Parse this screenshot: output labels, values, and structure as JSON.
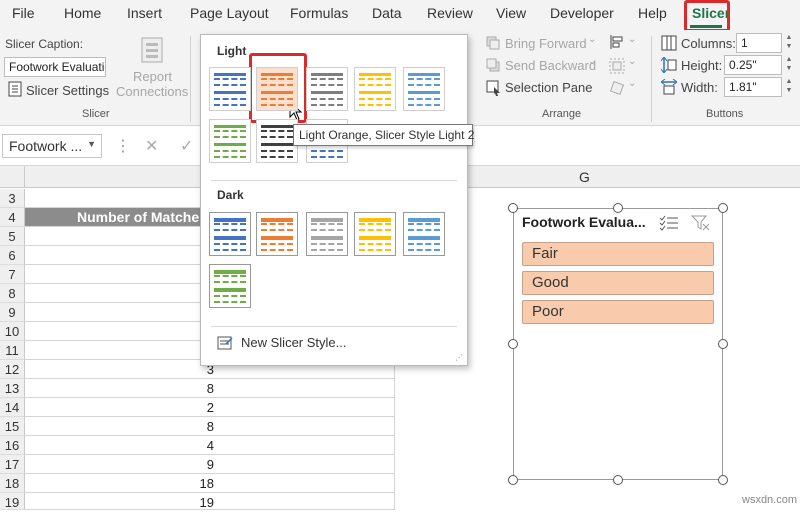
{
  "tabs": [
    "File",
    "Home",
    "Insert",
    "Page Layout",
    "Formulas",
    "Data",
    "Review",
    "View",
    "Developer",
    "Help",
    "Slicer"
  ],
  "active_tab": "Slicer",
  "ribbon": {
    "slicer_caption_label": "Slicer Caption:",
    "slicer_caption_value": "Footwork Evaluatio",
    "slicer_settings": "Slicer Settings",
    "report_connections_line1": "Report",
    "report_connections_line2": "Connections",
    "slicer_group": "Slicer",
    "bring_forward": "Bring Forward",
    "send_backward": "Send Backward",
    "selection_pane": "Selection Pane",
    "arrange_group": "Arrange",
    "columns_label": "Columns:",
    "columns_value": "1",
    "height_label": "Height:",
    "height_value": "0.25\"",
    "width_label": "Width:",
    "width_value": "1.81\"",
    "buttons_group": "Buttons"
  },
  "formula_bar": {
    "name_box": "Footwork ...",
    "cancel_icon": "close-icon",
    "enter_icon": "check-icon"
  },
  "columns": {
    "g": "G"
  },
  "header_cell": "Number of Matche",
  "rows": [
    {
      "n": "3",
      "v": ""
    },
    {
      "n": "4",
      "v": ""
    },
    {
      "n": "5",
      "v": ""
    },
    {
      "n": "6",
      "v": ""
    },
    {
      "n": "7",
      "v": ""
    },
    {
      "n": "8",
      "v": ""
    },
    {
      "n": "9",
      "v": ""
    },
    {
      "n": "10",
      "v": ""
    },
    {
      "n": "11",
      "v": ""
    },
    {
      "n": "12",
      "v": "3"
    },
    {
      "n": "13",
      "v": "8"
    },
    {
      "n": "14",
      "v": "2"
    },
    {
      "n": "15",
      "v": "8"
    },
    {
      "n": "16",
      "v": "4"
    },
    {
      "n": "17",
      "v": "9"
    },
    {
      "n": "18",
      "v": "18"
    },
    {
      "n": "19",
      "v": "19"
    }
  ],
  "gallery": {
    "light_label": "Light",
    "dark_label": "Dark",
    "new_style": "New Slicer Style...",
    "light_colors": [
      "#4472c4",
      "#ed7d31",
      "#7f7f7f",
      "#ffc000",
      "#5b9bd5",
      "#70ad47",
      "#404040",
      "#4472c4"
    ],
    "dark_colors": [
      "#4472c4",
      "#ed7d31",
      "#a5a5a5",
      "#ffc000",
      "#5b9bd5",
      "#70ad47"
    ]
  },
  "tooltip": "Light Orange, Slicer Style Light 2",
  "slicer": {
    "title": "Footwork Evalua...",
    "items": [
      "Fair",
      "Good",
      "Poor"
    ],
    "item_color": "#f8cbad"
  },
  "watermark": "wsxdn.com"
}
